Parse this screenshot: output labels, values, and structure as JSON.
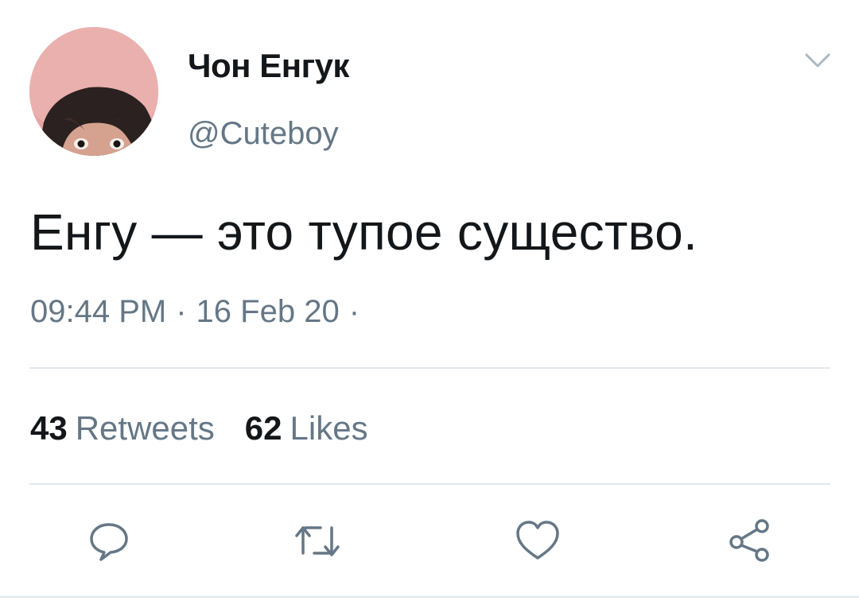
{
  "tweet": {
    "display_name": "Чон Енгук",
    "handle": "@Cuteboy",
    "text": "Енгу — это тупое существо.",
    "time": "09:44 PM",
    "date": "16 Feb 20",
    "separator": "·",
    "trailing_separator": "·"
  },
  "stats": {
    "retweets_count": "43",
    "retweets_label": "Retweets",
    "likes_count": "62",
    "likes_label": "Likes"
  },
  "icons": {
    "more": "chevron-down-icon",
    "reply": "reply-icon",
    "retweet": "retweet-icon",
    "like": "heart-icon",
    "share": "share-icon"
  },
  "colors": {
    "text_primary": "#14171a",
    "text_secondary": "#657786",
    "divider": "#e1e8ed",
    "icon": "#657786"
  }
}
